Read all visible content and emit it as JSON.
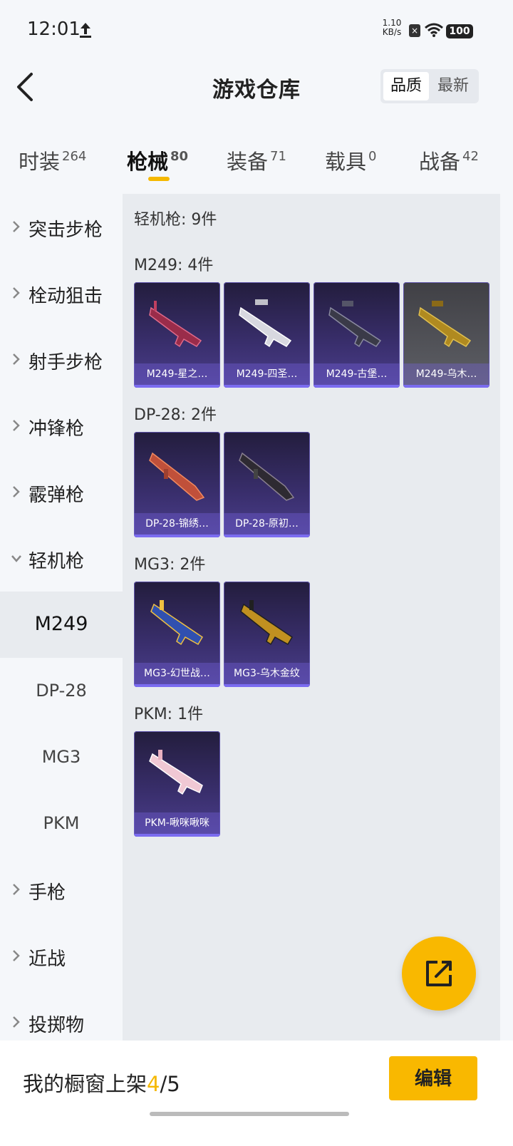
{
  "status_bar": {
    "time": "12:01",
    "net_speed_value": "1.10",
    "net_speed_unit": "KB/s",
    "battery": "100",
    "icons": [
      "upload-icon",
      "sim-icon",
      "wifi-icon",
      "battery-icon"
    ]
  },
  "header": {
    "title": "游戏仓库",
    "sort_options": [
      "品质",
      "最新"
    ],
    "active_sort": "品质"
  },
  "tabs": [
    {
      "label": "时装",
      "count": "264"
    },
    {
      "label": "枪械",
      "count": "80"
    },
    {
      "label": "装备",
      "count": "71"
    },
    {
      "label": "载具",
      "count": "0"
    },
    {
      "label": "战备",
      "count": "42"
    }
  ],
  "active_tab": "枪械",
  "sidebar": {
    "items": [
      {
        "label": "突击步枪",
        "expanded": false
      },
      {
        "label": "栓动狙击",
        "expanded": false
      },
      {
        "label": "射手步枪",
        "expanded": false
      },
      {
        "label": "冲锋枪",
        "expanded": false
      },
      {
        "label": "霰弹枪",
        "expanded": false
      },
      {
        "label": "轻机枪",
        "expanded": true
      },
      {
        "label": "手枪",
        "expanded": false
      },
      {
        "label": "近战",
        "expanded": false
      },
      {
        "label": "投掷物",
        "expanded": false
      }
    ],
    "sub_items": [
      "M249",
      "DP-28",
      "MG3",
      "PKM"
    ],
    "active_sub": "M249"
  },
  "content": {
    "category_summary": "轻机枪: 9件",
    "groups": [
      {
        "title": "M249: 4件",
        "items": [
          "M249-星之…",
          "M249-四圣…",
          "M249-古堡…",
          "M249-乌木…"
        ]
      },
      {
        "title": "DP-28: 2件",
        "items": [
          "DP-28-锦绣…",
          "DP-28-原初…"
        ]
      },
      {
        "title": "MG3: 2件",
        "items": [
          "MG3-幻世战…",
          "MG3-乌木金纹"
        ]
      },
      {
        "title": "PKM: 1件",
        "items": [
          "PKM-啾咪啾咪"
        ]
      }
    ]
  },
  "bottom_bar": {
    "showcase_prefix": "我的橱窗上架",
    "showcase_current": "4",
    "showcase_total": "/5",
    "edit_label": "编辑"
  },
  "colors": {
    "accent": "#f9b800",
    "card_purple": "#3a2f6e",
    "card_grey": "#55565c"
  }
}
